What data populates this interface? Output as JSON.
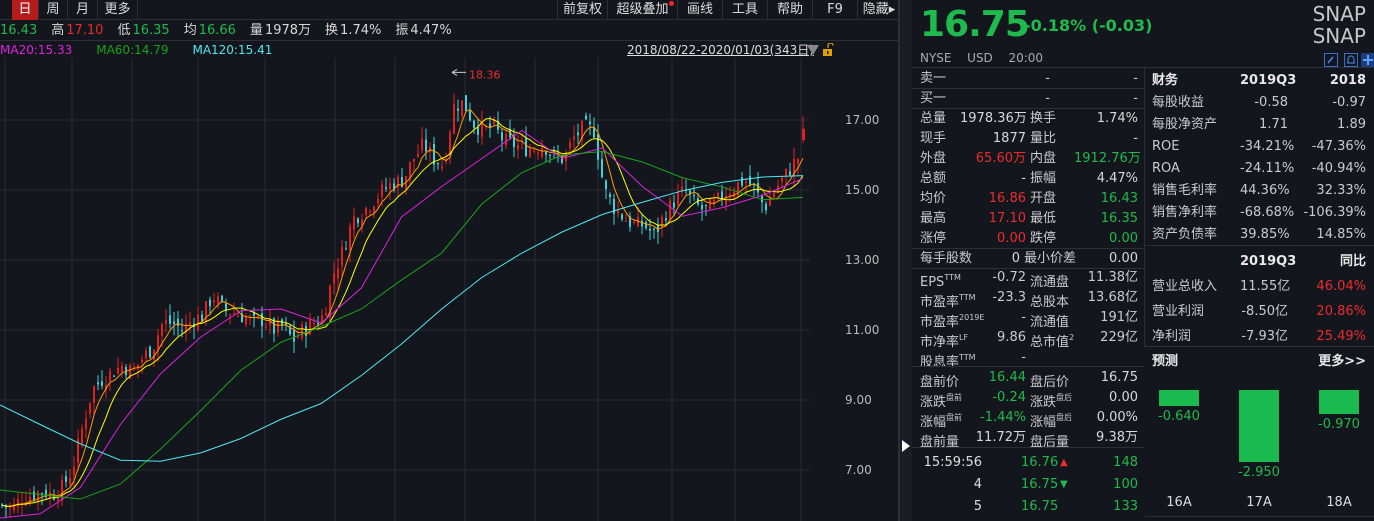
{
  "toolbar": {
    "period_tabs": [
      {
        "label": "日",
        "active": true
      },
      {
        "label": "周"
      },
      {
        "label": "月"
      },
      {
        "label": "更多"
      }
    ],
    "buttons": [
      {
        "label": "前复权"
      },
      {
        "label": "超级叠加",
        "dot": true
      },
      {
        "label": "画线"
      },
      {
        "label": "工具"
      },
      {
        "label": "帮助"
      },
      {
        "label": "F9"
      },
      {
        "label": "隐藏▸"
      }
    ]
  },
  "quote_line": [
    {
      "label": "",
      "value": "16.43",
      "color": "g"
    },
    {
      "label": "高",
      "value": "17.10",
      "color": "r"
    },
    {
      "label": "低",
      "value": "16.35",
      "color": "g"
    },
    {
      "label": "均",
      "value": "16.66",
      "color": "g"
    },
    {
      "label": "量",
      "value": "1978万",
      "color": "w"
    },
    {
      "label": "换",
      "value": "1.74%",
      "color": "w"
    },
    {
      "label": "振",
      "value": "4.47%",
      "color": "w"
    }
  ],
  "ma_legend": [
    {
      "text": "MA20:15.33",
      "color": "#e020e0"
    },
    {
      "text": "MA60:14.79",
      "color": "#19a319"
    },
    {
      "text": "MA120:15.41",
      "color": "#4fe8f0"
    }
  ],
  "date_range": "2018/08/22-2020/01/03(343日)",
  "chart_data": {
    "type": "candlestick",
    "y_ticks": [
      "17.00",
      "15.00",
      "13.00",
      "11.00",
      "9.00",
      "7.00"
    ],
    "ylim": [
      5.4,
      19.0
    ],
    "grid": true,
    "peak_label": "18.36",
    "colors": {
      "up": "#e0201f",
      "down": "#3fd0d8",
      "ma5": "#ff9a00",
      "ma10": "#ffff00",
      "ma20": "#e020e0",
      "ma60": "#19a319",
      "ma120": "#4fe8f0"
    },
    "closes": [
      6.0,
      5.9,
      6.2,
      6.3,
      6.4,
      6.3,
      6.5,
      7.0,
      8.2,
      9.3,
      9.6,
      9.8,
      10.0,
      9.8,
      10.2,
      10.5,
      11.2,
      11.2,
      11.0,
      11.3,
      11.4,
      12.0,
      11.6,
      11.5,
      11.4,
      11.2,
      11.3,
      11.0,
      11.1,
      10.7,
      11.0,
      11.2,
      11.4,
      12.6,
      13.3,
      14.2,
      14.4,
      14.7,
      15.0,
      15.2,
      15.3,
      15.9,
      16.3,
      15.9,
      15.7,
      17.4,
      17.5,
      16.9,
      16.7,
      16.8,
      16.4,
      16.3,
      16.2,
      16.2,
      16.3,
      15.9,
      15.9,
      16.5,
      16.8,
      16.7,
      15.0,
      14.5,
      14.2,
      14.0,
      14.0,
      13.7,
      14.3,
      14.7,
      15.0,
      14.6,
      14.4,
      14.6,
      14.9,
      15.1,
      15.3,
      15.0,
      14.5,
      15.0,
      15.4,
      15.8,
      16.2
    ],
    "last_candle": {
      "open": 16.43,
      "high": 17.1,
      "low": 16.35,
      "close": 16.75
    },
    "ma20": [
      5.63,
      5.75,
      6.5,
      8.3,
      9.75,
      10.8,
      11.55,
      11.6,
      11.2,
      12.2,
      14.23,
      15.1,
      15.9,
      16.7,
      15.9,
      16.2,
      15.1,
      14.25,
      14.5,
      14.85,
      15.33
    ],
    "ma60": [
      6.43,
      6.3,
      6.17,
      6.6,
      7.6,
      8.7,
      9.85,
      10.65,
      11.1,
      11.6,
      12.43,
      13.2,
      14.6,
      15.5,
      16.0,
      16.1,
      15.8,
      15.35,
      15.08,
      14.72,
      14.79
    ],
    "ma120": [
      8.86,
      8.3,
      7.75,
      7.28,
      7.25,
      7.49,
      7.9,
      8.45,
      8.9,
      9.7,
      10.6,
      11.6,
      12.5,
      13.2,
      13.8,
      14.3,
      14.65,
      14.98,
      15.22,
      15.37,
      15.41
    ]
  },
  "header": {
    "price": "16.75",
    "change": "-0.18% (-0.03)",
    "symbol1": "SNAP",
    "symbol2": "SNAP",
    "exchange": "NYSE",
    "currency": "USD",
    "time": "20:00"
  },
  "order_book": [
    {
      "label": "卖一",
      "price": "-",
      "vol": "-"
    },
    {
      "label": "买一",
      "price": "-",
      "vol": "-"
    }
  ],
  "stats": [
    [
      "总量",
      "1978.36万",
      "w",
      "换手",
      "1.74%",
      "w"
    ],
    [
      "现手",
      "1877",
      "w",
      "量比",
      "-",
      "w"
    ],
    [
      "外盘",
      "65.60万",
      "r",
      "内盘",
      "1912.76万",
      "g"
    ],
    [
      "总额",
      "-",
      "w",
      "振幅",
      "4.47%",
      "w"
    ],
    [
      "均价",
      "16.86",
      "r",
      "开盘",
      "16.43",
      "g"
    ],
    [
      "最高",
      "17.10",
      "r",
      "最低",
      "16.35",
      "g"
    ],
    [
      "涨停",
      "0.00",
      "r",
      "跌停",
      "0.00",
      "g"
    ],
    [
      "每手股数",
      "0",
      "w",
      "最小价差",
      "0.00",
      "w"
    ]
  ],
  "valuation": [
    [
      "EPS",
      "TTM",
      "-0.72",
      "流通盘",
      "",
      "11.38亿"
    ],
    [
      "市盈率",
      "TTM",
      "-23.3",
      "总股本",
      "",
      "13.68亿"
    ],
    [
      "市盈率",
      "2019E",
      "-",
      "流通值",
      "",
      "191亿"
    ],
    [
      "市净率",
      "LF",
      "9.86",
      "总市值",
      "2",
      "229亿"
    ],
    [
      "股息率",
      "TTM",
      "-",
      "",
      "",
      ""
    ]
  ],
  "extended": [
    [
      "盘前价",
      "",
      "16.44",
      "g",
      "盘后价",
      "",
      "16.75",
      "w"
    ],
    [
      "涨跌",
      "盘前",
      "-0.24",
      "g",
      "涨跌",
      "盘后",
      "0.00",
      "w"
    ],
    [
      "涨幅",
      "盘前",
      "-1.44%",
      "g",
      "涨幅",
      "盘后",
      "0.00%",
      "w"
    ],
    [
      "盘前量",
      "",
      "11.72万",
      "w",
      "盘后量",
      "",
      "9.38万",
      "w"
    ]
  ],
  "ticks": [
    {
      "time": "15:59:56",
      "price": "16.76",
      "dir": "up",
      "vol": "148"
    },
    {
      "time": "4",
      "price": "16.75",
      "dir": "down",
      "vol": "100"
    },
    {
      "time": "5",
      "price": "16.75",
      "dir": "",
      "vol": "133"
    }
  ],
  "finance": {
    "header": [
      "财务",
      "2019Q3",
      "2018"
    ],
    "rows": [
      [
        "每股收益",
        "-0.58",
        "-0.97"
      ],
      [
        "每股净资产",
        "1.71",
        "1.89"
      ],
      [
        "ROE",
        "-34.21%",
        "-47.36%"
      ],
      [
        "ROA",
        "-24.11%",
        "-40.94%"
      ],
      [
        "销售毛利率",
        "44.36%",
        "32.33%"
      ],
      [
        "销售净利率",
        "-68.68%",
        "-106.39%"
      ],
      [
        "资产负债率",
        "39.85%",
        "14.85%"
      ]
    ]
  },
  "income": {
    "header": [
      "",
      "2019Q3",
      "同比"
    ],
    "rows": [
      [
        "营业总收入",
        "11.55亿",
        "46.04%"
      ],
      [
        "营业利润",
        "-8.50亿",
        "20.86%"
      ],
      [
        "净利润",
        "-7.93亿",
        "25.49%"
      ]
    ]
  },
  "forecast": {
    "title": "预测",
    "more": "更多>>",
    "items": [
      {
        "year": "16A",
        "eps": -0.64,
        "label": "-0.640"
      },
      {
        "year": "17A",
        "eps": -2.95,
        "label": "-2.950"
      },
      {
        "year": "18A",
        "eps": -0.97,
        "label": "-0.970"
      }
    ]
  }
}
